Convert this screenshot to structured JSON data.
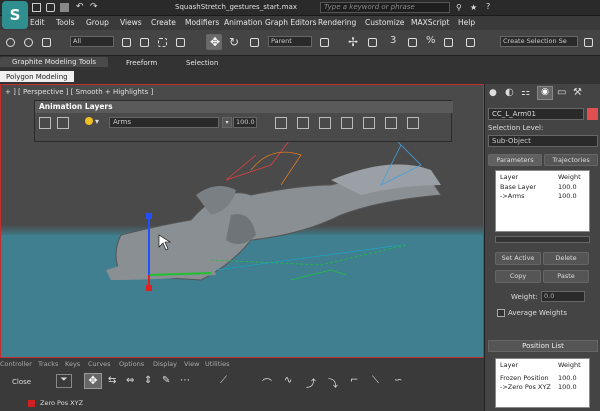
{
  "app": {
    "title": "SquashStretch_gestures_start.max",
    "search_placeholder": "Type a keyword or phrase",
    "logo": "S"
  },
  "menu": [
    "Edit",
    "Tools",
    "Group",
    "Views",
    "Create",
    "Modifiers",
    "Animation",
    "Graph Editors",
    "Rendering",
    "Customize",
    "MAXScript",
    "Help"
  ],
  "toolbar": {
    "filter_value": "All",
    "refcoord_value": "Parent",
    "selection_set": "Create Selection Se"
  },
  "ribbon": {
    "tabs": [
      "Graphite Modeling Tools",
      "Freeform",
      "Selection"
    ],
    "sub": "Polygon Modeling"
  },
  "viewport": {
    "label": "+ ] [ Perspective ] [ Smooth + Highlights ]"
  },
  "anim_layers": {
    "title": "Animation Layers",
    "layer": "Arms",
    "weight": "100.0"
  },
  "panel": {
    "object_name": "CC_L_Arm01",
    "selection_level_label": "Selection Level:",
    "selection_level_value": "Sub-Object",
    "tabs": [
      "Parameters",
      "Trajectories"
    ],
    "layer_list": {
      "col_layer": "Layer",
      "col_weight": "Weight",
      "rows": [
        {
          "name": "Base Layer",
          "w": "100.0"
        },
        {
          "name": "->Arms",
          "w": "100.0"
        }
      ]
    },
    "buttons": {
      "set_active": "Set Active",
      "delete": "Delete",
      "copy": "Copy",
      "paste": "Paste"
    },
    "weight_label": "Weight:",
    "weight_value": "0.0",
    "average_weights": "Average Weights",
    "position_list": {
      "title": "Position List",
      "col_layer": "Layer",
      "col_weight": "Weight",
      "rows": [
        {
          "name": "Frozen Position",
          "w": "100.0"
        },
        {
          "name": "->Zero Pos XYZ",
          "w": "100.0"
        }
      ]
    }
  },
  "bottom": {
    "tabs": [
      "Controller",
      "Tracks",
      "Keys",
      "Curves",
      "Options",
      "Display",
      "View",
      "Utilities"
    ],
    "close": "Close",
    "track": "Zero Pos XYZ"
  }
}
